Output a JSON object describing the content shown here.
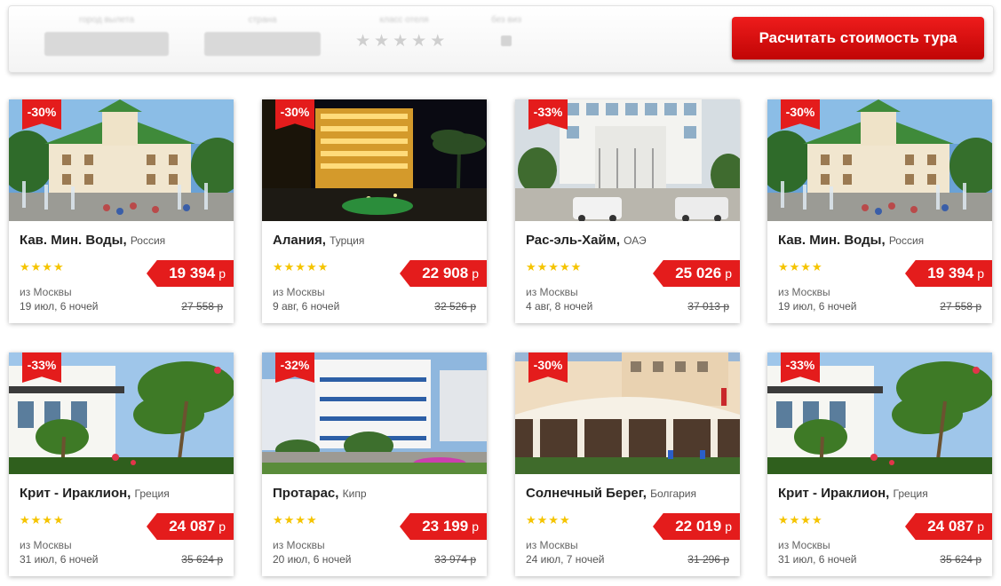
{
  "search": {
    "labels": [
      "город вылета",
      "страна",
      "класс отеля",
      "без виз"
    ],
    "stars_placeholder": "★★★★★",
    "button_label": "Расчитать стоимость тура"
  },
  "currency": "р",
  "cards": [
    {
      "discount": "-30%",
      "title": "Кав. Мин. Воды",
      "country": "Россия",
      "stars": "★★★★",
      "price": "19 394",
      "from": "из Москвы",
      "dates": "19 июл, 6 ночей",
      "old_price": "27 558 р",
      "image": "hotel-fountain-photo"
    },
    {
      "discount": "-30%",
      "title": "Алания",
      "country": "Турция",
      "stars": "★★★★★",
      "price": "22 908",
      "from": "из Москвы",
      "dates": "9 авг, 6 ночей",
      "old_price": "32 526 р",
      "image": "hotel-night-photo"
    },
    {
      "discount": "-33%",
      "title": "Рас-эль-Хайм",
      "country": "ОАЭ",
      "stars": "★★★★★",
      "price": "25 026",
      "from": "из Москвы",
      "dates": "4 авг, 8 ночей",
      "old_price": "37 013 р",
      "image": "hotel-white-building-photo"
    },
    {
      "discount": "-30%",
      "title": "Кав. Мин. Воды",
      "country": "Россия",
      "stars": "★★★★",
      "price": "19 394",
      "from": "из Москвы",
      "dates": "19 июл, 6 ночей",
      "old_price": "27 558 р",
      "image": "hotel-fountain-photo"
    },
    {
      "discount": "-33%",
      "title": "Крит - Ираклион",
      "country": "Греция",
      "stars": "★★★★",
      "price": "24 087",
      "from": "из Москвы",
      "dates": "31 июл, 6 ночей",
      "old_price": "35 624 р",
      "image": "hotel-palms-photo"
    },
    {
      "discount": "-32%",
      "title": "Протарас",
      "country": "Кипр",
      "stars": "★★★★",
      "price": "23 199",
      "from": "из Москвы",
      "dates": "20 июл, 6 ночей",
      "old_price": "33 974 р",
      "image": "hotel-apartments-photo"
    },
    {
      "discount": "-30%",
      "title": "Солнечный Берег",
      "country": "Болгария",
      "stars": "★★★★",
      "price": "22 019",
      "from": "из Москвы",
      "dates": "24 июл, 7 ночей",
      "old_price": "31 296 р",
      "image": "hotel-royal-sun-photo"
    },
    {
      "discount": "-33%",
      "title": "Крит - Ираклион",
      "country": "Греция",
      "stars": "★★★★",
      "price": "24 087",
      "from": "из Москвы",
      "dates": "31 июл, 6 ночей",
      "old_price": "35 624 р",
      "image": "hotel-palms-photo"
    }
  ]
}
